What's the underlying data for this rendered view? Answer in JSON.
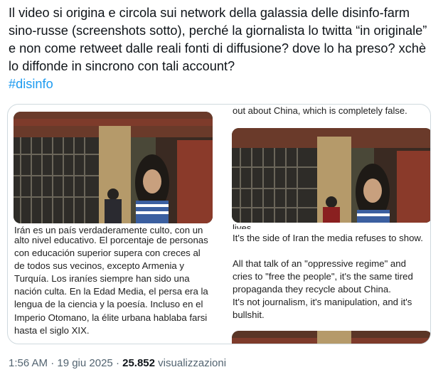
{
  "tweet": {
    "text": "Il video si origina e circola sui network della galassia delle disinfo-farm sino-russe (screenshots sotto), perché la giornalista lo twitta “in originale” e non come retweet dalle reali fonti di diffusione? dove lo ha preso? xchè lo diffonde in sincrono con tali account?",
    "hashtag": "#disinfo"
  },
  "media": {
    "left_caption_cut": "Irán es un país verdaderamente culto, con un",
    "left_caption": "alto nivel educativo. El porcentaje de personas con educación superior supera con creces al de todos sus vecinos, excepto Armenia y Turquía. Los iraníes siempre han sido una nación culta. En la Edad Media, el persa era la lengua de la ciencia y la poesía. Incluso en el Imperio Otomano, la élite urbana hablaba farsi hasta el siglo XIX.",
    "right_top_line": "out about China, which is completely false.",
    "right_caption_cut": "lives.",
    "right_para1": "It's the side of Iran the media refuses to show.",
    "right_para2": "All that talk of an \"oppressive regime\" and cries to \"free the people\", it's the same tired propaganda they recycle about China.",
    "right_para3": "It's not journalism, it's manipulation, and it's bullshit."
  },
  "meta": {
    "time_date": "1:56 AM · 19 giu 2025 ·",
    "views_count": "25.852",
    "views_label": "visualizzazioni"
  },
  "colors": {
    "accent": "#1d9bf0",
    "text": "#0f1419",
    "muted": "#536471",
    "border": "#cfd9de"
  }
}
